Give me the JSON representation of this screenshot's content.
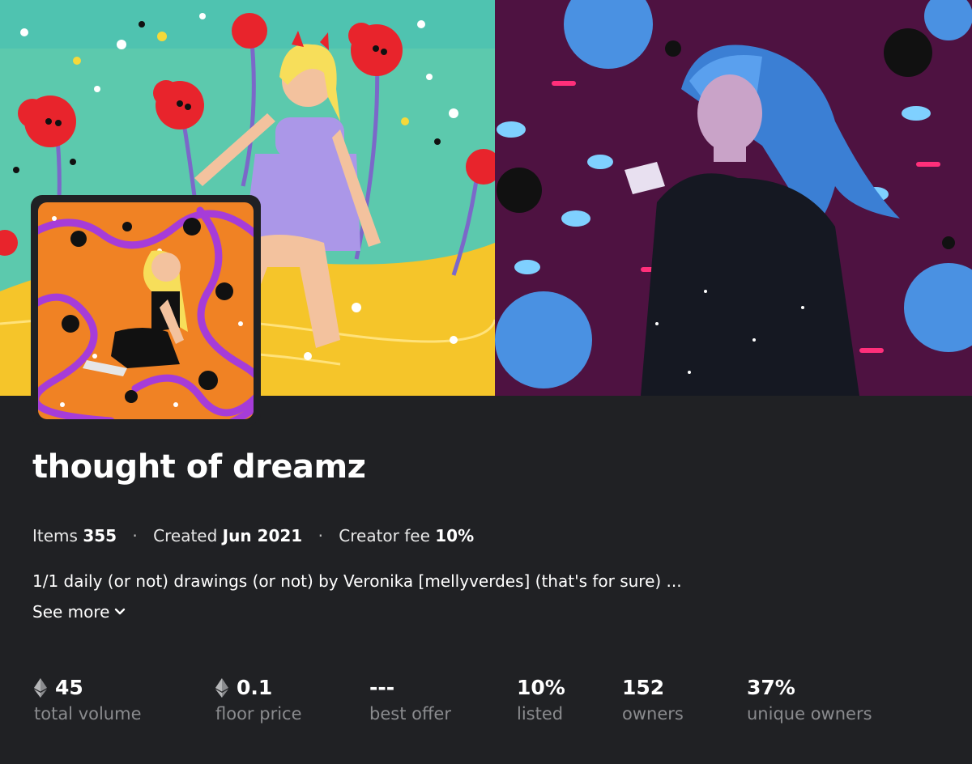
{
  "collection": {
    "name": "thought of dreamz",
    "meta": {
      "items_label": "Items",
      "items_value": "355",
      "created_label": "Created",
      "created_value": "Jun 2021",
      "fee_label": "Creator fee",
      "fee_value": "10%",
      "separator": "·"
    },
    "description": "1/1 daily (or not) drawings (or not) by Veronika [mellyverdes] (that's for sure) ...",
    "see_more_label": "See more"
  },
  "stats": [
    {
      "icon": "ethereum-icon",
      "value": "45",
      "label": "total volume"
    },
    {
      "icon": "ethereum-icon",
      "value": "0.1",
      "label": "floor price"
    },
    {
      "icon": "",
      "value": "---",
      "label": "best offer"
    },
    {
      "icon": "",
      "value": "10%",
      "label": "listed"
    },
    {
      "icon": "",
      "value": "152",
      "label": "owners"
    },
    {
      "icon": "",
      "value": "37%",
      "label": "unique owners"
    }
  ],
  "colors": {
    "background": "#202124",
    "muted_text": "#8a8b8e",
    "banner_left_sky": "#5cc9ad",
    "banner_left_ground": "#f5c52a",
    "banner_right_bg": "#5a1545",
    "avatar_bg": "#f08224"
  }
}
